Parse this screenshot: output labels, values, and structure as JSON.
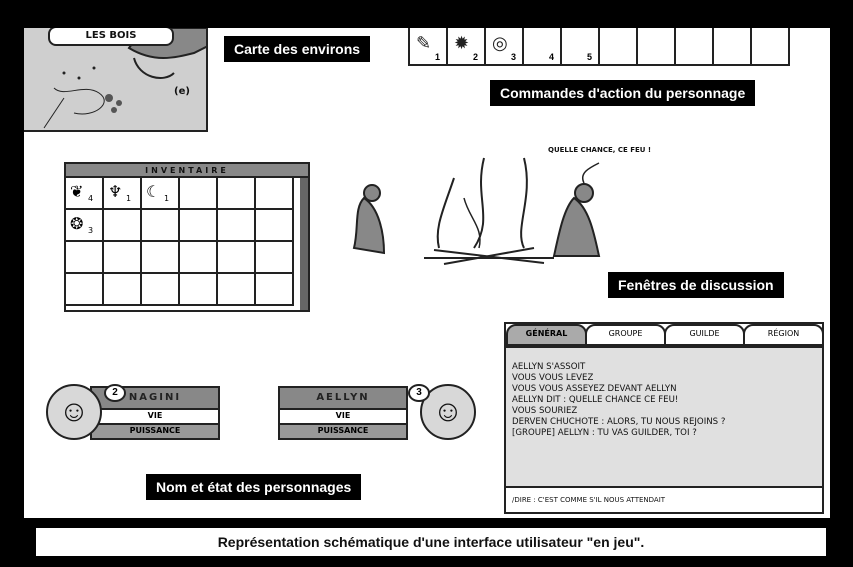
{
  "map": {
    "title": "LES BOIS",
    "marker": "(e)"
  },
  "labels": {
    "map": "Carte des environs",
    "actions": "Commandes d'action du personnage",
    "chat": "Fenêtres de discussion",
    "characters": "Nom et état des personnages"
  },
  "action_bar": {
    "slots": [
      {
        "icon": "✎",
        "num": "1"
      },
      {
        "icon": "✹",
        "num": "2"
      },
      {
        "icon": "◎",
        "num": "3"
      },
      {
        "icon": "",
        "num": "4"
      },
      {
        "icon": "",
        "num": "5"
      },
      {
        "icon": "",
        "num": ""
      },
      {
        "icon": "",
        "num": ""
      },
      {
        "icon": "",
        "num": ""
      },
      {
        "icon": "",
        "num": ""
      },
      {
        "icon": "",
        "num": ""
      }
    ]
  },
  "inventory": {
    "title": "INVENTAIRE",
    "items": [
      {
        "icon": "❦",
        "count": "4"
      },
      {
        "icon": "♆",
        "count": "1"
      },
      {
        "icon": "☾",
        "count": "1"
      },
      {
        "icon": "❂",
        "count": "3"
      }
    ]
  },
  "scene": {
    "speech": "QUELLE CHANCE, CE FEU !"
  },
  "chat": {
    "tabs": [
      "GÉNÉRAL",
      "GROUPE",
      "GUILDE",
      "RÉGION"
    ],
    "lines": [
      "AELLYN S'ASSOIT",
      "VOUS VOUS LEVEZ",
      "VOUS VOUS ASSEYEZ DEVANT AELLYN",
      "AELLYN DIT : QUELLE CHANCE CE FEU!",
      "VOUS SOURIEZ",
      "DERVEN CHUCHOTE : ALORS, TU NOUS REJOINS ?",
      "[GROUPE] AELLYN : TU VAS GUILDER, TOI ?"
    ],
    "input": "/DIRE : C'EST COMME S'IL NOUS ATTENDAIT"
  },
  "characters": [
    {
      "name": "NAGINI",
      "level": "2",
      "vie": "VIE",
      "puissance": "PUISSANCE"
    },
    {
      "name": "AELLYN",
      "level": "3",
      "vie": "VIE",
      "puissance": "PUISSANCE"
    }
  ],
  "caption": "Représentation schématique d'une interface utilisateur \"en jeu\"."
}
